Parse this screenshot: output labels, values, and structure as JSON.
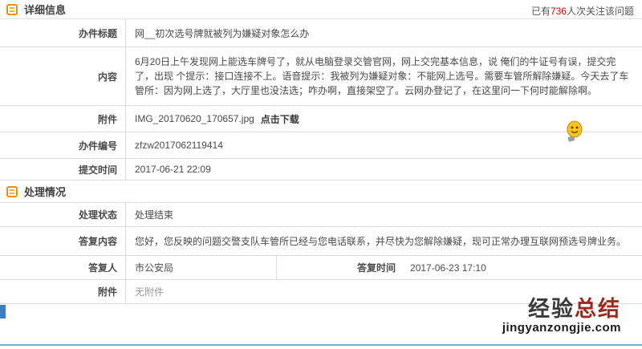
{
  "header": {
    "title": "详细信息",
    "followers_prefix": "已有",
    "followers_count": "736",
    "followers_suffix": "人次关注该问题"
  },
  "detail": {
    "title_label": "办件标题",
    "title_value": "网__初次选号牌就被列为嫌疑对象怎么办",
    "content_label": "内容",
    "content_value": "6月20日上午发现网上能选车牌号了，就从电脑登录交管官网，网上交完基本信息，说 俺们的牛证号有误，提交完了，出现 个提示：接口连接不上。语音提示：我被列为嫌疑对象：不能网上选号。需要车管所解除嫌疑。今天去了车管所：因为网上选了，大厅里也没法选；咋办啊，直接架空了。云网办登记了，在这里问一下何时能解除啊。",
    "attachment_label": "附件",
    "attachment_file": "IMG_20170620_170657.jpg",
    "attachment_download": "点击下载",
    "case_no_label": "办件编号",
    "case_no_value": "zfzw2017062119414",
    "submit_time_label": "提交时间",
    "submit_time_value": "2017-06-21 22:09"
  },
  "process": {
    "title": "处理情况",
    "status_label": "处理状态",
    "status_value": "处理结束",
    "reply_label": "答复内容",
    "reply_value": "您好，您反映的问题交警支队车管所已经与您电话联系，并尽快为您解除嫌疑，现可正常办理互联网预选号牌业务。",
    "replier_label": "答复人",
    "replier_value": "市公安局",
    "reply_time_label": "答复时间",
    "reply_time_value": "2017-06-23 17:10",
    "attachment_label": "附件",
    "attachment_value": "无附件"
  },
  "watermark": {
    "brand_dark": "经验",
    "brand_red": "总结",
    "site": "jingyanzongjie.com"
  },
  "colors": {
    "accent_orange": "#e8920a",
    "count_red": "#e60000",
    "brand_red": "#9c2b1f",
    "bottom_bar_blue": "#74b3d6",
    "border_gray": "#dcdcdc"
  }
}
